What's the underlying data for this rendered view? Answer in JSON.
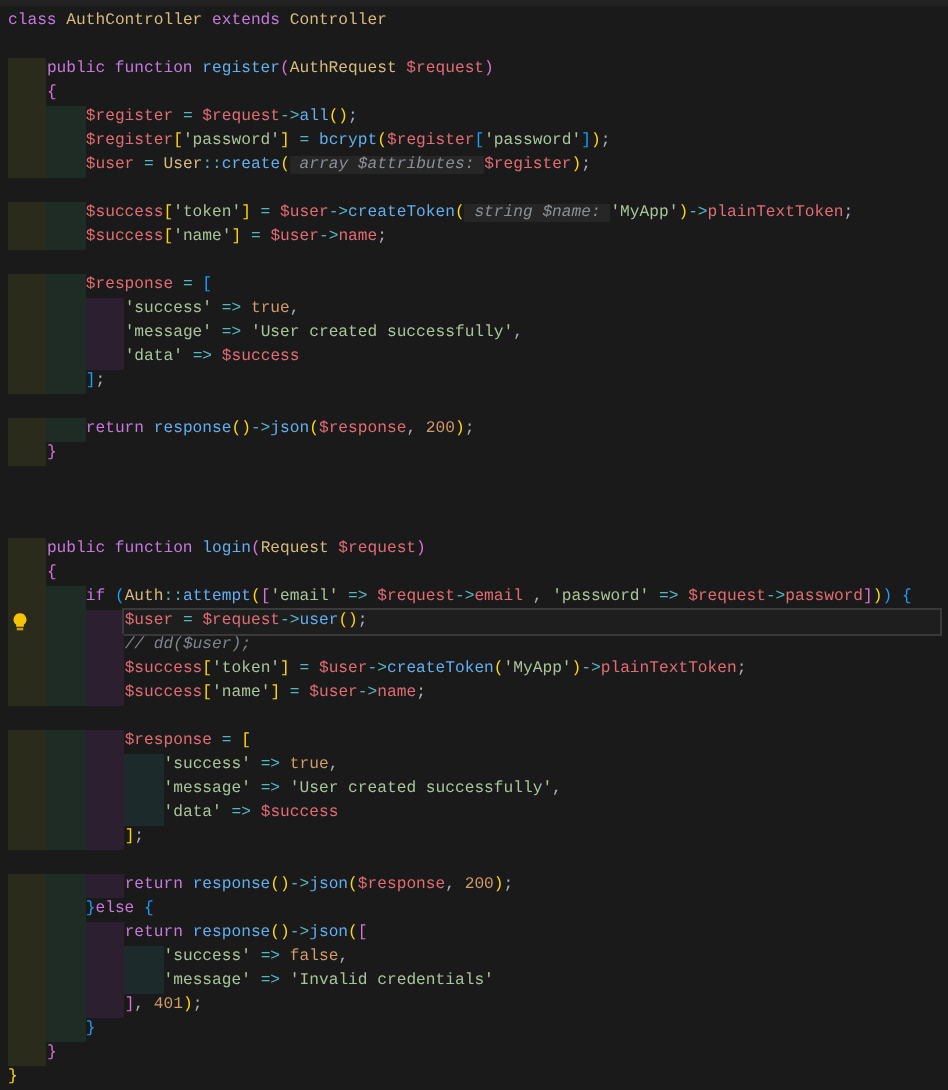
{
  "editor": {
    "lines": [
      {
        "kind": "code",
        "current": false,
        "tokens": [
          {
            "text": "class ",
            "kind": "k"
          },
          {
            "text": "AuthController ",
            "kind": "c"
          },
          {
            "text": "extends ",
            "kind": "k"
          },
          {
            "text": "Controller",
            "kind": "c"
          }
        ]
      },
      {
        "kind": "blank"
      },
      {
        "kind": "code",
        "current": false,
        "tokens": [
          {
            "text": "    public function ",
            "kind": "k"
          },
          {
            "text": "register",
            "kind": "f"
          },
          {
            "text": "(",
            "kind": "b1"
          },
          {
            "text": "AuthRequest ",
            "kind": "c"
          },
          {
            "text": "$request",
            "kind": "v"
          },
          {
            "text": ")",
            "kind": "b1"
          }
        ]
      },
      {
        "kind": "code",
        "current": false,
        "tokens": [
          {
            "text": "    {",
            "kind": "b1"
          }
        ]
      },
      {
        "kind": "code",
        "current": false,
        "tokens": [
          {
            "text": "        $register",
            "kind": "v"
          },
          {
            "text": " = ",
            "kind": "o"
          },
          {
            "text": "$request",
            "kind": "v"
          },
          {
            "text": "->",
            "kind": "o"
          },
          {
            "text": "all",
            "kind": "f"
          },
          {
            "text": "()",
            "kind": "b2"
          },
          {
            "text": ";",
            "kind": "p"
          }
        ]
      },
      {
        "kind": "code",
        "current": false,
        "tokens": [
          {
            "text": "        $register",
            "kind": "v"
          },
          {
            "text": "[",
            "kind": "b2"
          },
          {
            "text": "'password'",
            "kind": "s"
          },
          {
            "text": "]",
            "kind": "b2"
          },
          {
            "text": " = ",
            "kind": "o"
          },
          {
            "text": "bcrypt",
            "kind": "f"
          },
          {
            "text": "(",
            "kind": "b2"
          },
          {
            "text": "$register",
            "kind": "v"
          },
          {
            "text": "[",
            "kind": "b3"
          },
          {
            "text": "'password'",
            "kind": "s"
          },
          {
            "text": "]",
            "kind": "b3"
          },
          {
            "text": ")",
            "kind": "b2"
          },
          {
            "text": ";",
            "kind": "p"
          }
        ]
      },
      {
        "kind": "code",
        "current": false,
        "tokens": [
          {
            "text": "        $user",
            "kind": "v"
          },
          {
            "text": " = ",
            "kind": "o"
          },
          {
            "text": "User",
            "kind": "c"
          },
          {
            "text": "::",
            "kind": "o"
          },
          {
            "text": "create",
            "kind": "f"
          },
          {
            "text": "(",
            "kind": "b2"
          },
          {
            "text": " array $attributes: ",
            "kind": "h"
          },
          {
            "text": "$register",
            "kind": "v"
          },
          {
            "text": ")",
            "kind": "b2"
          },
          {
            "text": ";",
            "kind": "p"
          }
        ]
      },
      {
        "kind": "blank"
      },
      {
        "kind": "code",
        "current": false,
        "tokens": [
          {
            "text": "        $success",
            "kind": "v"
          },
          {
            "text": "[",
            "kind": "b2"
          },
          {
            "text": "'token'",
            "kind": "s"
          },
          {
            "text": "]",
            "kind": "b2"
          },
          {
            "text": " = ",
            "kind": "o"
          },
          {
            "text": "$user",
            "kind": "v"
          },
          {
            "text": "->",
            "kind": "o"
          },
          {
            "text": "createToken",
            "kind": "f"
          },
          {
            "text": "(",
            "kind": "b2"
          },
          {
            "text": " string $name: ",
            "kind": "h"
          },
          {
            "text": "'MyApp'",
            "kind": "s"
          },
          {
            "text": ")",
            "kind": "b2"
          },
          {
            "text": "->",
            "kind": "o"
          },
          {
            "text": "plainTextToken",
            "kind": "v"
          },
          {
            "text": ";",
            "kind": "p"
          }
        ]
      },
      {
        "kind": "code",
        "current": false,
        "tokens": [
          {
            "text": "        $success",
            "kind": "v"
          },
          {
            "text": "[",
            "kind": "b2"
          },
          {
            "text": "'name'",
            "kind": "s"
          },
          {
            "text": "]",
            "kind": "b2"
          },
          {
            "text": " = ",
            "kind": "o"
          },
          {
            "text": "$user",
            "kind": "v"
          },
          {
            "text": "->",
            "kind": "o"
          },
          {
            "text": "name",
            "kind": "v"
          },
          {
            "text": ";",
            "kind": "p"
          }
        ]
      },
      {
        "kind": "blank"
      },
      {
        "kind": "code",
        "current": false,
        "tokens": [
          {
            "text": "        $response",
            "kind": "v"
          },
          {
            "text": " = ",
            "kind": "o"
          },
          {
            "text": "[",
            "kind": "b3"
          }
        ]
      },
      {
        "kind": "code",
        "current": false,
        "tokens": [
          {
            "text": "            'success'",
            "kind": "s"
          },
          {
            "text": " => ",
            "kind": "o"
          },
          {
            "text": "true",
            "kind": "n"
          },
          {
            "text": ",",
            "kind": "p"
          }
        ]
      },
      {
        "kind": "code",
        "current": false,
        "tokens": [
          {
            "text": "            'message'",
            "kind": "s"
          },
          {
            "text": " => ",
            "kind": "o"
          },
          {
            "text": "'User created successfully'",
            "kind": "s"
          },
          {
            "text": ",",
            "kind": "p"
          }
        ]
      },
      {
        "kind": "code",
        "current": false,
        "tokens": [
          {
            "text": "            'data'",
            "kind": "s"
          },
          {
            "text": " => ",
            "kind": "o"
          },
          {
            "text": "$success",
            "kind": "v"
          }
        ]
      },
      {
        "kind": "code",
        "current": false,
        "tokens": [
          {
            "text": "        ]",
            "kind": "b3"
          },
          {
            "text": ";",
            "kind": "p"
          }
        ]
      },
      {
        "kind": "blank"
      },
      {
        "kind": "code",
        "current": false,
        "tokens": [
          {
            "text": "        return ",
            "kind": "k"
          },
          {
            "text": "response",
            "kind": "f"
          },
          {
            "text": "()",
            "kind": "b2"
          },
          {
            "text": "->",
            "kind": "o"
          },
          {
            "text": "json",
            "kind": "f"
          },
          {
            "text": "(",
            "kind": "b2"
          },
          {
            "text": "$response",
            "kind": "v"
          },
          {
            "text": ", ",
            "kind": "p"
          },
          {
            "text": "200",
            "kind": "n"
          },
          {
            "text": ")",
            "kind": "b2"
          },
          {
            "text": ";",
            "kind": "p"
          }
        ]
      },
      {
        "kind": "code",
        "current": false,
        "tokens": [
          {
            "text": "    }",
            "kind": "b1"
          }
        ]
      },
      {
        "kind": "blank"
      },
      {
        "kind": "blank"
      },
      {
        "kind": "blank"
      },
      {
        "kind": "code",
        "current": false,
        "tokens": [
          {
            "text": "    public function ",
            "kind": "k"
          },
          {
            "text": "login",
            "kind": "f"
          },
          {
            "text": "(",
            "kind": "b1"
          },
          {
            "text": "Request ",
            "kind": "c"
          },
          {
            "text": "$request",
            "kind": "v"
          },
          {
            "text": ")",
            "kind": "b1"
          }
        ]
      },
      {
        "kind": "code",
        "current": false,
        "tokens": [
          {
            "text": "    {",
            "kind": "b1"
          }
        ]
      },
      {
        "kind": "code",
        "current": false,
        "tokens": [
          {
            "text": "        if ",
            "kind": "k"
          },
          {
            "text": "(",
            "kind": "b3"
          },
          {
            "text": "Auth",
            "kind": "c"
          },
          {
            "text": "::",
            "kind": "o"
          },
          {
            "text": "attempt",
            "kind": "f"
          },
          {
            "text": "(",
            "kind": "b2"
          },
          {
            "text": "[",
            "kind": "b1"
          },
          {
            "text": "'email'",
            "kind": "s"
          },
          {
            "text": " => ",
            "kind": "o"
          },
          {
            "text": "$request",
            "kind": "v"
          },
          {
            "text": "->",
            "kind": "o"
          },
          {
            "text": "email",
            "kind": "v"
          },
          {
            "text": " , ",
            "kind": "p"
          },
          {
            "text": "'password'",
            "kind": "s"
          },
          {
            "text": " => ",
            "kind": "o"
          },
          {
            "text": "$request",
            "kind": "v"
          },
          {
            "text": "->",
            "kind": "o"
          },
          {
            "text": "password",
            "kind": "v"
          },
          {
            "text": "]",
            "kind": "b1"
          },
          {
            "text": ")",
            "kind": "b2"
          },
          {
            "text": ")",
            "kind": "b3"
          },
          {
            "text": " {",
            "kind": "b3"
          }
        ]
      },
      {
        "kind": "code",
        "current": true,
        "tokens": [
          {
            "text": "            $user",
            "kind": "v"
          },
          {
            "text": " = ",
            "kind": "o"
          },
          {
            "text": "$request",
            "kind": "v"
          },
          {
            "text": "->",
            "kind": "o"
          },
          {
            "text": "user",
            "kind": "f"
          },
          {
            "text": "()",
            "kind": "b2"
          },
          {
            "text": ";",
            "kind": "p"
          }
        ]
      },
      {
        "kind": "code",
        "current": false,
        "tokens": [
          {
            "text": "            // dd($user);",
            "kind": "m"
          }
        ]
      },
      {
        "kind": "code",
        "current": false,
        "tokens": [
          {
            "text": "            $success",
            "kind": "v"
          },
          {
            "text": "[",
            "kind": "b2"
          },
          {
            "text": "'token'",
            "kind": "s"
          },
          {
            "text": "]",
            "kind": "b2"
          },
          {
            "text": " = ",
            "kind": "o"
          },
          {
            "text": "$user",
            "kind": "v"
          },
          {
            "text": "->",
            "kind": "o"
          },
          {
            "text": "createToken",
            "kind": "f"
          },
          {
            "text": "(",
            "kind": "b2"
          },
          {
            "text": "'MyApp'",
            "kind": "s"
          },
          {
            "text": ")",
            "kind": "b2"
          },
          {
            "text": "->",
            "kind": "o"
          },
          {
            "text": "plainTextToken",
            "kind": "v"
          },
          {
            "text": ";",
            "kind": "p"
          }
        ]
      },
      {
        "kind": "code",
        "current": false,
        "tokens": [
          {
            "text": "            $success",
            "kind": "v"
          },
          {
            "text": "[",
            "kind": "b2"
          },
          {
            "text": "'name'",
            "kind": "s"
          },
          {
            "text": "]",
            "kind": "b2"
          },
          {
            "text": " = ",
            "kind": "o"
          },
          {
            "text": "$user",
            "kind": "v"
          },
          {
            "text": "->",
            "kind": "o"
          },
          {
            "text": "name",
            "kind": "v"
          },
          {
            "text": ";",
            "kind": "p"
          }
        ]
      },
      {
        "kind": "blank"
      },
      {
        "kind": "code",
        "current": false,
        "tokens": [
          {
            "text": "            $response",
            "kind": "v"
          },
          {
            "text": " = ",
            "kind": "o"
          },
          {
            "text": "[",
            "kind": "b2"
          }
        ]
      },
      {
        "kind": "code",
        "current": false,
        "tokens": [
          {
            "text": "                'success'",
            "kind": "s"
          },
          {
            "text": " => ",
            "kind": "o"
          },
          {
            "text": "true",
            "kind": "n"
          },
          {
            "text": ",",
            "kind": "p"
          }
        ]
      },
      {
        "kind": "code",
        "current": false,
        "tokens": [
          {
            "text": "                'message'",
            "kind": "s"
          },
          {
            "text": " => ",
            "kind": "o"
          },
          {
            "text": "'User created successfully'",
            "kind": "s"
          },
          {
            "text": ",",
            "kind": "p"
          }
        ]
      },
      {
        "kind": "code",
        "current": false,
        "tokens": [
          {
            "text": "                'data'",
            "kind": "s"
          },
          {
            "text": " => ",
            "kind": "o"
          },
          {
            "text": "$success",
            "kind": "v"
          }
        ]
      },
      {
        "kind": "code",
        "current": false,
        "tokens": [
          {
            "text": "            ]",
            "kind": "b2"
          },
          {
            "text": ";",
            "kind": "p"
          }
        ]
      },
      {
        "kind": "blank"
      },
      {
        "kind": "code",
        "current": false,
        "tokens": [
          {
            "text": "            return ",
            "kind": "k"
          },
          {
            "text": "response",
            "kind": "f"
          },
          {
            "text": "()",
            "kind": "b2"
          },
          {
            "text": "->",
            "kind": "o"
          },
          {
            "text": "json",
            "kind": "f"
          },
          {
            "text": "(",
            "kind": "b2"
          },
          {
            "text": "$response",
            "kind": "v"
          },
          {
            "text": ", ",
            "kind": "p"
          },
          {
            "text": "200",
            "kind": "n"
          },
          {
            "text": ")",
            "kind": "b2"
          },
          {
            "text": ";",
            "kind": "p"
          }
        ]
      },
      {
        "kind": "code",
        "current": false,
        "tokens": [
          {
            "text": "        }",
            "kind": "b3"
          },
          {
            "text": "else ",
            "kind": "k"
          },
          {
            "text": "{",
            "kind": "b3"
          }
        ]
      },
      {
        "kind": "code",
        "current": false,
        "tokens": [
          {
            "text": "            return ",
            "kind": "k"
          },
          {
            "text": "response",
            "kind": "f"
          },
          {
            "text": "()",
            "kind": "b2"
          },
          {
            "text": "->",
            "kind": "o"
          },
          {
            "text": "json",
            "kind": "f"
          },
          {
            "text": "(",
            "kind": "b2"
          },
          {
            "text": "[",
            "kind": "b1"
          }
        ]
      },
      {
        "kind": "code",
        "current": false,
        "tokens": [
          {
            "text": "                'success'",
            "kind": "s"
          },
          {
            "text": " => ",
            "kind": "o"
          },
          {
            "text": "false",
            "kind": "n"
          },
          {
            "text": ",",
            "kind": "p"
          }
        ]
      },
      {
        "kind": "code",
        "current": false,
        "tokens": [
          {
            "text": "                'message'",
            "kind": "s"
          },
          {
            "text": " => ",
            "kind": "o"
          },
          {
            "text": "'Invalid credentials'",
            "kind": "s"
          }
        ]
      },
      {
        "kind": "code",
        "current": false,
        "tokens": [
          {
            "text": "            ]",
            "kind": "b1"
          },
          {
            "text": ", ",
            "kind": "p"
          },
          {
            "text": "401",
            "kind": "n"
          },
          {
            "text": ")",
            "kind": "b2"
          },
          {
            "text": ";",
            "kind": "p"
          }
        ]
      },
      {
        "kind": "code",
        "current": false,
        "tokens": [
          {
            "text": "        }",
            "kind": "b3"
          }
        ]
      },
      {
        "kind": "code",
        "current": false,
        "tokens": [
          {
            "text": "    }",
            "kind": "b1"
          }
        ]
      },
      {
        "kind": "code",
        "current": false,
        "tokens": [
          {
            "text": "}",
            "kind": "b2"
          }
        ]
      }
    ]
  }
}
